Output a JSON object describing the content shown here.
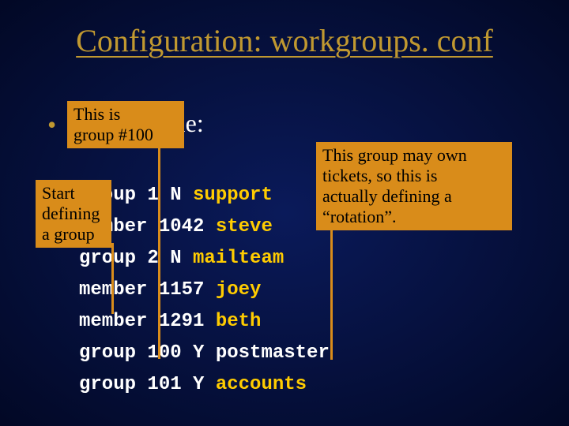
{
  "title": "Configuration: workgroups. conf",
  "bullet": "•",
  "bullet_text": "For example:",
  "code": {
    "l1a": "group 1 N ",
    "l1b": "support",
    "l2a": "member 1042 ",
    "l2b": "steve",
    "l3a": "group 2 N ",
    "l3b": "mailteam",
    "l4a": "member 1157 ",
    "l4b": "joey",
    "l5a": "member 1291 ",
    "l5b": "beth",
    "l6": "group 100 Y postmaster",
    "l7a": "group 101 Y ",
    "l7b": "accounts"
  },
  "callouts": {
    "top_left_l1": "This is",
    "top_left_l2": "group #100",
    "left_l1": "Start",
    "left_l2": "defining",
    "left_l3": "a group",
    "right_l1": "This group may own",
    "right_l2": "tickets, so this is",
    "right_l3": "actually defining a",
    "right_l4": "“rotation”."
  }
}
